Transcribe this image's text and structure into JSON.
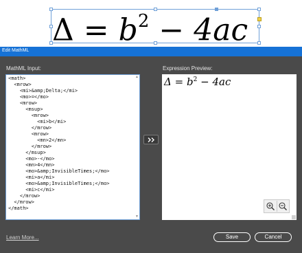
{
  "canvas": {
    "formula": {
      "lhs": "Δ",
      "equals": "=",
      "base": "b",
      "exponent": "2",
      "minus": "−",
      "rest": "4ac"
    }
  },
  "dialog": {
    "title": "Edit MathML",
    "input_label": "MathML Input:",
    "preview_label": "Expression Preview:",
    "mathml_source": "<math>\n  <mrow>\n    <mi>&amp;Delta;</mi>\n    <mo>=</mo>\n    <mrow>\n      <msup>\n        <mrow>\n          <mi>b</mi>\n        </mrow>\n        <mrow>\n          <mn>2</mn>\n        </mrow>\n      </msup>\n      <mo>-</mo>\n      <mn>4</mn>\n      <mo>&amp;InvisibleTimes;</mo>\n      <mi>a</mi>\n      <mo>&amp;InvisibleTimes;</mo>\n      <mi>c</mi>\n    </mrow>\n  </mrow>\n</math>",
    "preview": {
      "lhs": "Δ",
      "equals": "=",
      "base": "b",
      "exponent": "2",
      "minus": "−",
      "rest": "4ac"
    },
    "learn_more": "Learn More...",
    "save_label": "Save",
    "cancel_label": "Cancel",
    "icons": {
      "convert": "double-chevron-right-icon",
      "zoom_in": "zoom-in-icon",
      "zoom_out": "zoom-out-icon"
    }
  },
  "colors": {
    "titlebar": "#1672d6",
    "dialog_bg": "#4a4a4a",
    "selection": "#6fa0d8"
  }
}
